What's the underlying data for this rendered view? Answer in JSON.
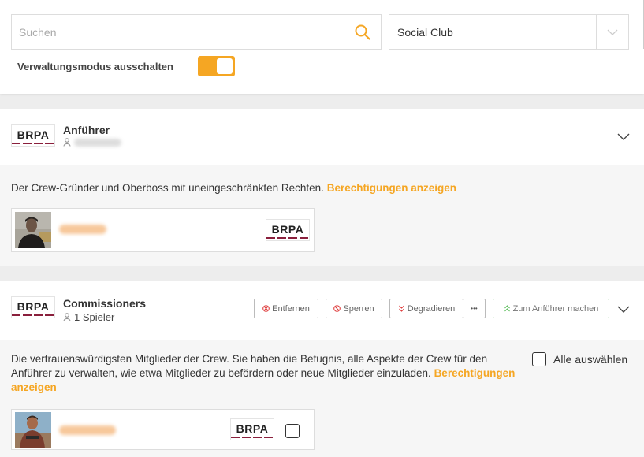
{
  "search": {
    "placeholder": "Suchen",
    "icon": "search-icon"
  },
  "platform_select": {
    "value": "Social Club"
  },
  "admin_toggle": {
    "label": "Verwaltungsmodus ausschalten",
    "on": true,
    "color": "#f5a623"
  },
  "crew_tag": "BRPA",
  "ranks": [
    {
      "title": "Anführer",
      "description": "Der Crew-Gründer und Oberboss mit uneingeschränkten Rechten.",
      "permissions_link": "Berechtigungen anzeigen",
      "member_tag": "BRPA"
    },
    {
      "title": "Commissioners",
      "count": "1 Spieler",
      "description": "Die vertrauenswürdigsten Mitglieder der Crew. Sie haben die Befugnis, alle Aspekte der Crew für den Anführer zu verwalten, wie etwa Mitglieder zu befördern oder neue Mitglieder einzuladen.",
      "permissions_link": "Berechtigungen anzeigen",
      "member_tag": "BRPA",
      "actions": {
        "remove": "Entfernen",
        "ban": "Sperren",
        "demote": "Degradieren",
        "more": "•••",
        "make_leader": "Zum Anführer machen"
      },
      "select_all": "Alle auswählen"
    }
  ],
  "colors": {
    "accent": "#f5a623",
    "tag_underline": "#8a1f3c"
  }
}
